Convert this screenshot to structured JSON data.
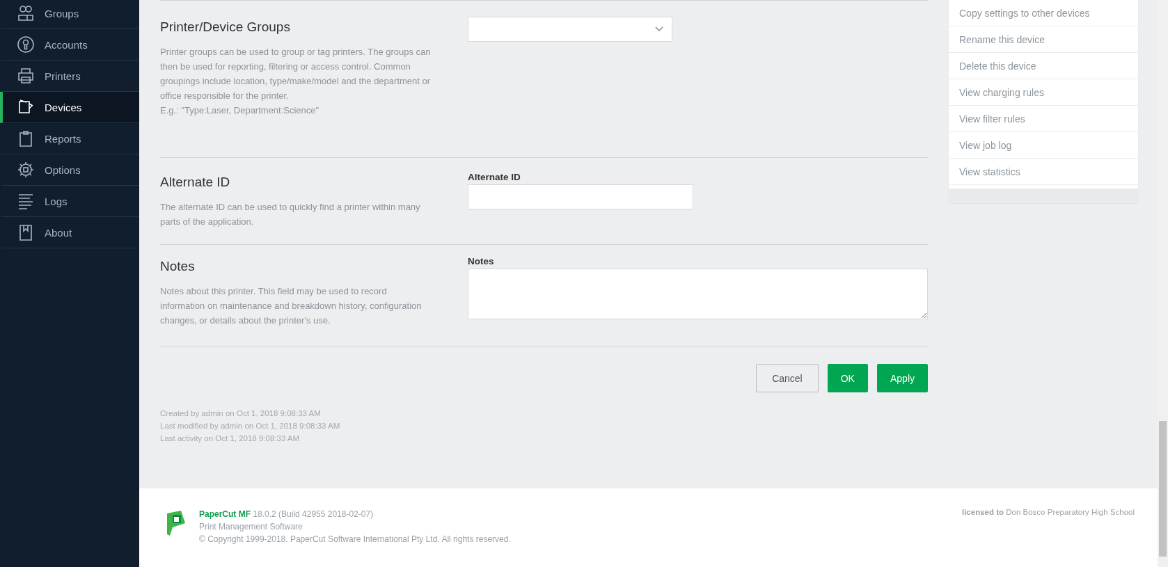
{
  "sidebar": {
    "items": [
      {
        "label": "Groups",
        "kind": "groups",
        "selected": false
      },
      {
        "label": "Accounts",
        "kind": "accounts",
        "selected": false
      },
      {
        "label": "Printers",
        "kind": "printers",
        "selected": false
      },
      {
        "label": "Devices",
        "kind": "devices",
        "selected": true
      },
      {
        "label": "Reports",
        "kind": "reports",
        "selected": false
      },
      {
        "label": "Options",
        "kind": "options",
        "selected": false
      },
      {
        "label": "Logs",
        "kind": "logs",
        "selected": false
      },
      {
        "label": "About",
        "kind": "about",
        "selected": false
      }
    ]
  },
  "sections": [
    {
      "title": "Printer/Device Groups",
      "description": "Printer groups can be used to group or tag printers. The groups can then be used for reporting, filtering or access control. Common groupings include location, type/make/model and the department or office responsible for the printer.",
      "example": "E.g.: \"Type:Laser, Department:Science\"",
      "field": {
        "kind": "dropdown"
      }
    },
    {
      "title": "Alternate ID",
      "description": "The alternate ID can be used to quickly find a printer within many parts of the application.",
      "field": {
        "kind": "input",
        "label": "Alternate ID"
      }
    },
    {
      "title": "Notes",
      "description": "Notes about this printer. This field may be used to record information on maintenance and breakdown history, configuration changes, or details about the printer's use.",
      "field": {
        "kind": "textarea",
        "label": "Notes"
      }
    }
  ],
  "buttons": [
    {
      "label": "Cancel",
      "kind": "secondary"
    },
    {
      "label": "OK",
      "kind": "primary"
    },
    {
      "label": "Apply",
      "kind": "primary"
    }
  ],
  "meta": [
    "Created by admin on Oct 1, 2018 9:08:33 AM",
    "Last modified by admin on Oct 1, 2018 9:08:33 AM",
    "Last activity on Oct 1, 2018 9:08:33 AM"
  ],
  "actions": [
    "Copy settings to other devices",
    "Rename this device",
    "Delete this device",
    "View charging rules",
    "View filter rules",
    "View job log",
    "View statistics"
  ],
  "footer": {
    "product": "PaperCut MF",
    "version": "18.0.2 (Build 42955 2018-02-07)",
    "subtitle": "Print Management Software",
    "copyright": "© Copyright 1999-2018. PaperCut Software International Pty Ltd. All rights reserved.",
    "license_label": "licensed to",
    "licensee": "Don Bosco Preparatory High School"
  }
}
